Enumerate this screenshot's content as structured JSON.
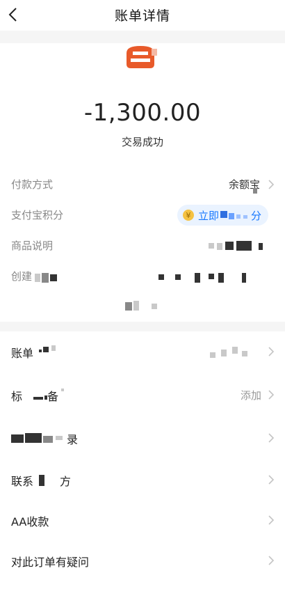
{
  "header": {
    "title": "账单详情",
    "back_icon": "chevron-left-icon"
  },
  "summary": {
    "merchant_icon": "merchant-logo-icon",
    "amount": "-1,300.00",
    "status": "交易成功"
  },
  "details": {
    "payment_method_label": "付款方式",
    "payment_method_value": "余额宝",
    "points_label": "支付宝积分",
    "points_action": "立即",
    "points_suffix": "分",
    "product_label": "商品说明",
    "created_label": "创建"
  },
  "actions": {
    "item1_label": "账单",
    "item2_label": "标",
    "item2_label2": "备",
    "item2_value": "添加",
    "item3_label": "录",
    "item4_label": "联系",
    "item4_label2": "方",
    "item5_label": "AA收款",
    "item6_label": "对此订单有疑问"
  },
  "colors": {
    "accent": "#1677ff",
    "merchant_icon": "#e85a2a",
    "coin": "#f5c242"
  }
}
